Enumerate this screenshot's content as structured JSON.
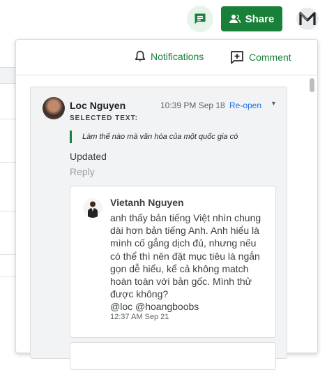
{
  "toolbar": {
    "share_label": "Share",
    "chat_icon": "comment-bubble-icon",
    "account_initial": "M"
  },
  "panel": {
    "notifications_label": "Notifications",
    "comment_label": "Comment",
    "thread": {
      "author": "Loc Nguyen",
      "timestamp": "10:39 PM Sep 18",
      "reopen_label": "Re-open",
      "selected_text_label": "SELECTED TEXT:",
      "selected_text": "Làm thế nào mà văn hóa của một quốc gia có",
      "body": "Updated",
      "reply_label": "Reply",
      "reply": {
        "author": "Vietanh Nguyen",
        "body": "anh thấy bản tiếng Việt nhìn chung dài hơn bản tiếng Anh. Anh hiểu là mình cố gắng dịch đủ, nhưng nếu có thể thì nên đặt mục tiêu là ngắn gọn dễ hiểu, kể cả không match hoàn toàn với bản gốc. Mình thử được không?",
        "mentions": "@loc @hoangboobs",
        "timestamp": "12:37 AM Sep 21"
      }
    }
  },
  "colors": {
    "accent_green": "#188038",
    "link_blue": "#1a73e8",
    "thread_bg": "#f1f3f4"
  }
}
